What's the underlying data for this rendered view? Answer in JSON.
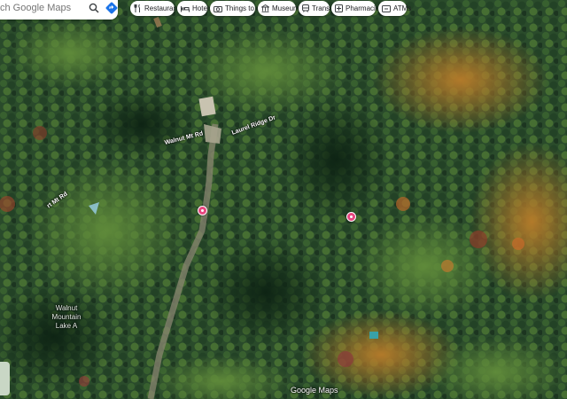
{
  "search": {
    "placeholder": "ch Google Maps",
    "search_icon": "search-icon",
    "directions_icon": "directions-icon"
  },
  "chips": [
    {
      "label": "Restaurants",
      "icon": "fork-knife-icon"
    },
    {
      "label": "Hotels",
      "icon": "bed-icon"
    },
    {
      "label": "Things to do",
      "icon": "camera-icon"
    },
    {
      "label": "Museums",
      "icon": "museum-icon"
    },
    {
      "label": "Transit",
      "icon": "train-icon"
    },
    {
      "label": "Pharmacies",
      "icon": "pharmacy-icon"
    },
    {
      "label": "ATMs",
      "icon": "atm-icon"
    }
  ],
  "map": {
    "roads": [
      "Walnut Mt Rd",
      "Laurel Ridge Dr",
      "rt Mt Rd"
    ],
    "area_label": "Walnut Mountain Lake A",
    "pin_color": "#e7477f",
    "watermark": "Google Maps"
  }
}
